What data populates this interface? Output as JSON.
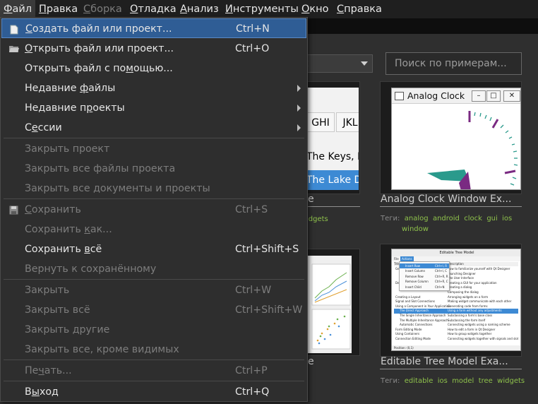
{
  "menubar": {
    "items": [
      {
        "label": "Файл",
        "accel": "Ф",
        "rest": "айл"
      },
      {
        "label": "Правка",
        "accel": "П",
        "rest": "равка"
      },
      {
        "label": "Сборка",
        "accel": "С",
        "rest": "борка"
      },
      {
        "label": "Отладка",
        "accel": "О",
        "rest": "тладка"
      },
      {
        "label": "Анализ",
        "accel": "А",
        "rest": "нализ"
      },
      {
        "label": "Инструменты",
        "accel": "И",
        "rest": "нструменты"
      },
      {
        "label": "Окно",
        "accel": "О",
        "rest": "кно"
      },
      {
        "label": "Справка",
        "accel": "С",
        "rest": "правка"
      }
    ]
  },
  "welcome": {
    "combo_text": "t",
    "search_placeholder": "Поиск по примерам...",
    "tags_label": "Теги:",
    "cards": [
      {
        "title": "Analog Clock Window Ex...",
        "tags": [
          "analog",
          "android",
          "clock",
          "gui",
          "ios",
          "window"
        ],
        "window_title": "Analog Clock"
      },
      {
        "title": "Editable Tree Model Exa...",
        "tags": [
          "editable",
          "ios",
          "model",
          "tree",
          "widgets"
        ],
        "window_title": "Editable Tree Model"
      }
    ],
    "partial": {
      "tab_ghi": "GHI",
      "tab_jkl": "JKL",
      "row1": "The Keys,  B",
      "row2": "The Lake Dis",
      "title1_tail": "e",
      "tag1_tail": "idgets",
      "title2_tail": "e"
    },
    "tree": {
      "menu_file": "File",
      "menu_actions": "Actions",
      "col_title": "Title",
      "col_desc": "Description",
      "status": "Position: (0,1)",
      "menu_items": [
        "Insert Row",
        "Insert Column",
        "Remove Row",
        "Remove Column",
        "Insert Child"
      ],
      "menu_shortcuts": [
        "Ctrl+I, R",
        "Ctrl+I, C",
        "Ctrl+R, R",
        "Ctrl+R, C",
        "Ctrl+N"
      ],
      "rows": [
        [
          "Getting Started",
          "How to familiarize yourself with Qt Designer"
        ],
        [
          "",
          "Launching Designer"
        ],
        [
          "",
          "The User Interface"
        ],
        [
          "Designing a Component",
          "Creating a GUI for your application"
        ],
        [
          "",
          "Creating a dialog"
        ],
        [
          "",
          "Composing the dialog"
        ],
        [
          "Creating a Layout",
          "Arranging widgets on a form"
        ],
        [
          "Signal and Slot Connections",
          "Making widget communicate with each other"
        ],
        [
          "Using a Component in Your Application",
          "Generating code from forms"
        ],
        [
          "The Direct Approach",
          "Using a form without any adjustments"
        ],
        [
          "The Single Inheritance Approach",
          "Subclassing a form's base class"
        ],
        [
          "The Multiple Inheritance Approach",
          "Subclassing the form itself"
        ],
        [
          "Automatic Connections",
          "Connecting widgets using a naming scheme"
        ],
        [
          "Form Editing Mode",
          "How to edit a form in Qt Designer"
        ],
        [
          "Using Containers",
          "How to group widgets together"
        ],
        [
          "Connection Editing Mode",
          "Connecting widgets together with signals and slots"
        ]
      ]
    }
  },
  "file_menu": {
    "items": [
      {
        "id": "new",
        "pre": "",
        "acc": "С",
        "post": "оздать файл или проект...",
        "shortcut": "Ctrl+N",
        "icon": "new-file-icon",
        "state": "highlighted"
      },
      {
        "id": "open",
        "pre": "",
        "acc": "О",
        "post": "ткрыть файл или проект...",
        "shortcut": "Ctrl+O",
        "icon": "open-folder-icon",
        "state": "enabled"
      },
      {
        "id": "open-with",
        "pre": "Открыть файл с по",
        "acc": "м",
        "post": "ощью...",
        "shortcut": "",
        "state": "enabled"
      },
      {
        "id": "recent-files",
        "pre": "Недавние ",
        "acc": "ф",
        "post": "айлы",
        "shortcut": "",
        "submenu": true,
        "state": "enabled"
      },
      {
        "id": "recent-projects",
        "pre": "Недавние п",
        "acc": "р",
        "post": "оекты",
        "shortcut": "",
        "submenu": true,
        "state": "enabled"
      },
      {
        "id": "sessions",
        "pre": "С",
        "acc": "е",
        "post": "ссии",
        "shortcut": "",
        "submenu": true,
        "state": "enabled"
      },
      {
        "id": "close-project",
        "pre": "Закрыть проект",
        "acc": "",
        "post": "",
        "shortcut": "",
        "state": "disabled"
      },
      {
        "id": "close-project-files",
        "pre": "Закрыть все файлы проекта",
        "acc": "",
        "post": "",
        "shortcut": "",
        "state": "disabled"
      },
      {
        "id": "close-all-docs",
        "pre": "Закрыть все документы и проекты",
        "acc": "",
        "post": "",
        "shortcut": "",
        "state": "disabled"
      },
      {
        "id": "save",
        "pre": "",
        "acc": "С",
        "post": "охранить",
        "shortcut": "Ctrl+S",
        "icon": "save-icon",
        "state": "disabled"
      },
      {
        "id": "save-as",
        "pre": "Сохранить ",
        "acc": "к",
        "post": "ак...",
        "shortcut": "",
        "state": "disabled"
      },
      {
        "id": "save-all",
        "pre": "Сохранить ",
        "acc": "в",
        "post": "сё",
        "shortcut": "Ctrl+Shift+S",
        "state": "enabled"
      },
      {
        "id": "revert",
        "pre": "Вернуть к сохранённому",
        "acc": "",
        "post": "",
        "shortcut": "",
        "state": "disabled"
      },
      {
        "id": "close",
        "pre": "Закрыть",
        "acc": "",
        "post": "",
        "shortcut": "Ctrl+W",
        "state": "disabled"
      },
      {
        "id": "close-all",
        "pre": "Закрыть всё",
        "acc": "",
        "post": "",
        "shortcut": "Ctrl+Shift+W",
        "state": "disabled"
      },
      {
        "id": "close-others",
        "pre": "Закрыть другие",
        "acc": "",
        "post": "",
        "shortcut": "",
        "state": "disabled"
      },
      {
        "id": "close-all-except-visible",
        "pre": "Закрыть все, кроме видимых",
        "acc": "",
        "post": "",
        "shortcut": "",
        "state": "disabled"
      },
      {
        "id": "print",
        "pre": "Пе",
        "acc": "ч",
        "post": "ать...",
        "shortcut": "Ctrl+P",
        "state": "disabled"
      },
      {
        "id": "exit",
        "pre": "В",
        "acc": "ы",
        "post": "ход",
        "shortcut": "Ctrl+Q",
        "state": "enabled"
      }
    ]
  },
  "colors": {
    "highlight": "#2f5d95",
    "tag_green": "#8ec14b",
    "menu_bg": "#2e2e2e",
    "clock_hand": "#2a9a8c",
    "clock_tick": "#8a2a8a"
  }
}
